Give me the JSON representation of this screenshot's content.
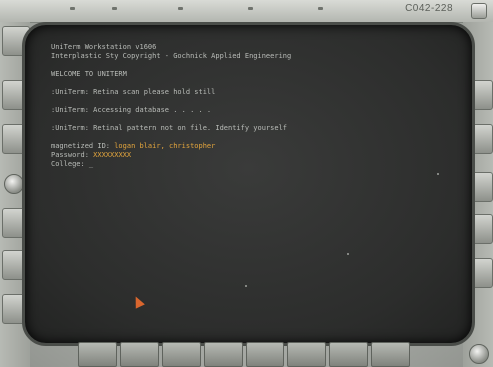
{
  "window": {
    "code_label": "C042-228"
  },
  "terminal": {
    "header_line1": "UniTerm Workstation v1606",
    "header_line2": "Interplastic Sty Copyright - Gochnick Applied Engineering",
    "welcome": "WELCOME TO UNITERM",
    "status1": ":UniTerm: Retina scan please hold still",
    "status2": ":UniTerm: Accessing database . . . . .",
    "status3": ":UniTerm: Retinal pattern not on file. Identify yourself",
    "login_prefix": "magnetized ID: ",
    "login_name": "logan blair, christopher",
    "password_prefix": "Password: ",
    "password_value": "XXXXXXXXX",
    "college_prompt": "College: _"
  },
  "accent_color": "#e3a53d",
  "cursor_icon": "arrow-cursor-icon"
}
